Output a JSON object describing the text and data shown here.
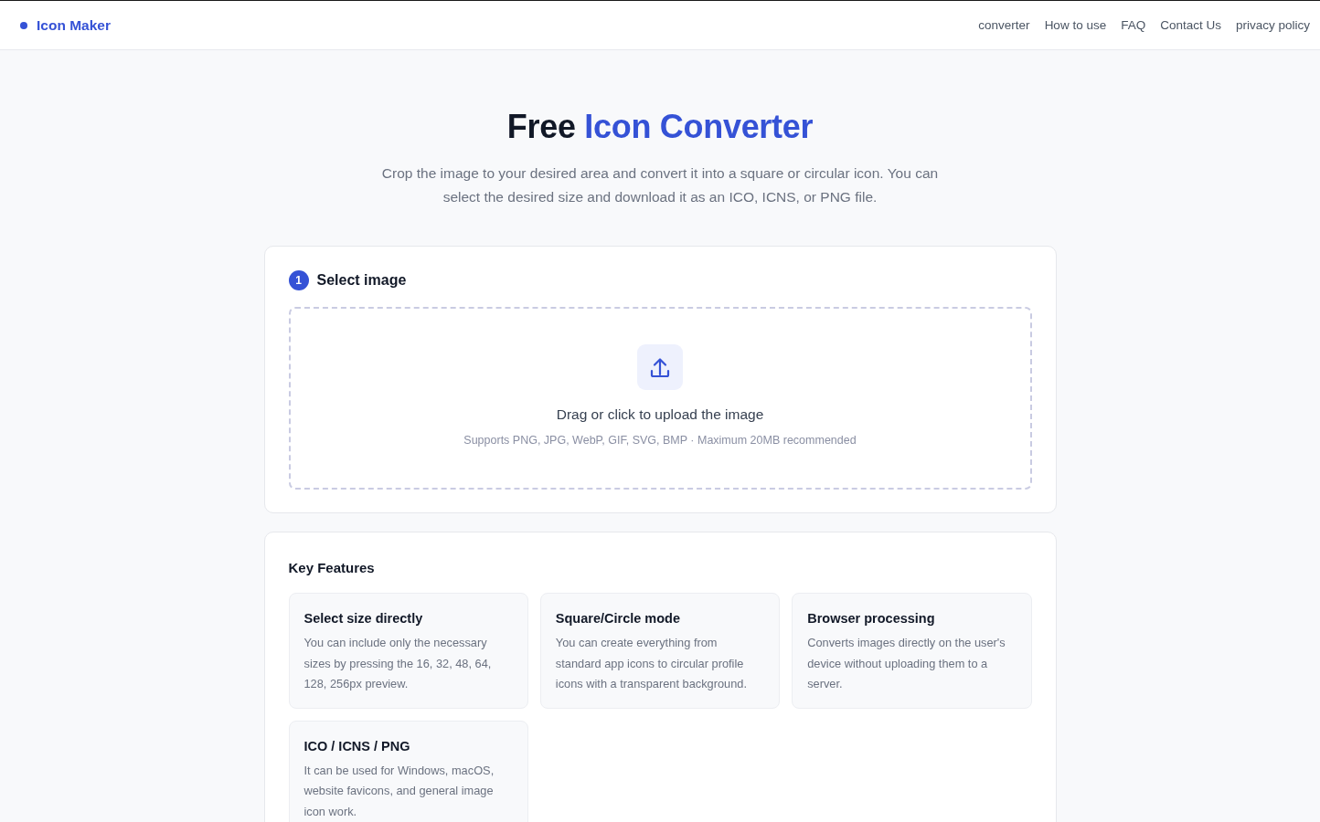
{
  "header": {
    "logo": "Icon Maker",
    "nav": [
      "converter",
      "How to use",
      "FAQ",
      "Contact Us",
      "privacy policy"
    ]
  },
  "hero": {
    "title_lead": "Free",
    "title_accent": "Icon Converter",
    "subtitle": "Crop the image to your desired area and convert it into a square or circular icon. You can select the desired size and download it as an ICO, ICNS, or PNG file."
  },
  "select_card": {
    "step": "1",
    "title": "Select image",
    "dropzone": {
      "prompt": "Drag or click to upload the image",
      "hint": "Supports PNG, JPG, WebP, GIF, SVG, BMP · Maximum 20MB recommended"
    }
  },
  "features": {
    "title": "Key Features",
    "items": [
      {
        "title": "Select size directly",
        "description": "You can include only the necessary sizes by pressing the 16, 32, 48, 64, 128, 256px preview."
      },
      {
        "title": "Square/Circle mode",
        "description": "You can create everything from standard app icons to circular profile icons with a transparent background."
      },
      {
        "title": "Browser processing",
        "description": "Converts images directly on the user's device without uploading them to a server."
      },
      {
        "title": "ICO / ICNS / PNG",
        "description": "It can be used for Windows, macOS, website favicons, and general image icon work."
      }
    ]
  }
}
